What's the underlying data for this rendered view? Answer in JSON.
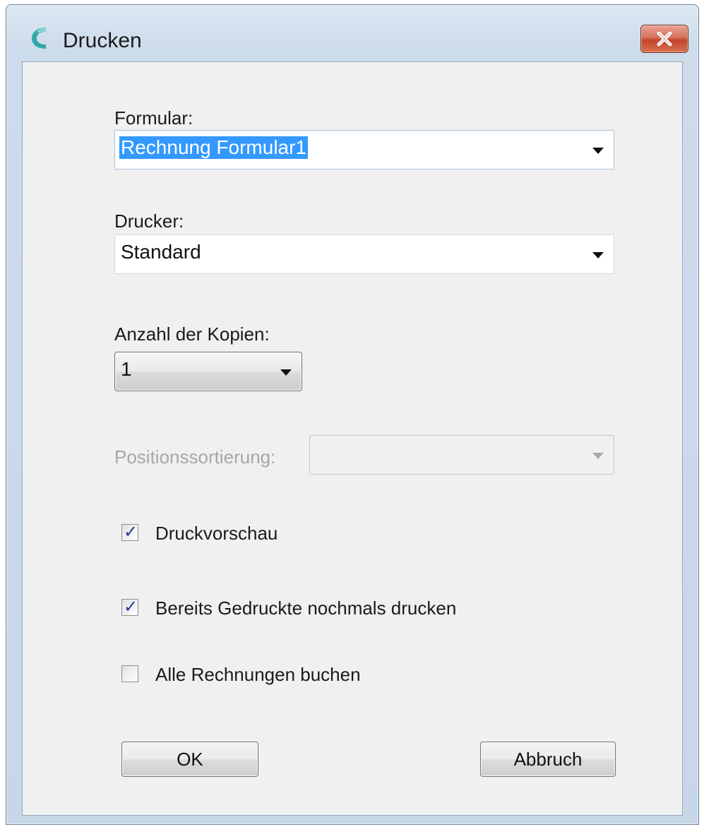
{
  "window": {
    "title": "Drucken",
    "close_label": "X"
  },
  "form": {
    "formular": {
      "label": "Formular:",
      "value": "Rechnung Formular1"
    },
    "drucker": {
      "label": "Drucker:",
      "value": "Standard"
    },
    "kopien": {
      "label": "Anzahl der Kopien:",
      "value": "1"
    },
    "positionssortierung": {
      "label": "Positionssortierung:",
      "value": ""
    },
    "checkboxes": [
      {
        "label": "Druckvorschau",
        "checked": true
      },
      {
        "label": "Bereits Gedruckte nochmals drucken",
        "checked": true
      },
      {
        "label": "Alle Rechnungen buchen",
        "checked": false
      }
    ]
  },
  "buttons": {
    "ok": "OK",
    "cancel": "Abbruch"
  },
  "colors": {
    "selection": "#3399ff",
    "app_icon": "#34a7a9",
    "close_button": "#c4432a",
    "client_bg": "#f0f0f0"
  },
  "icons": {
    "app": "app-logo-c-icon",
    "close": "close-icon",
    "dropdown": "chevron-down-icon",
    "check": "checkmark-icon"
  }
}
